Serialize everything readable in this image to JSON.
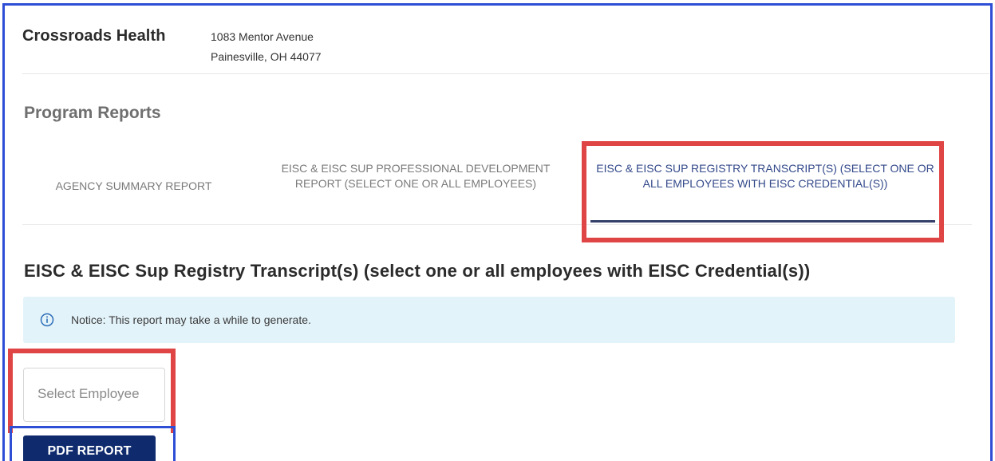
{
  "header": {
    "organization": "Crossroads Health",
    "address_line1": "1083 Mentor Avenue",
    "address_line2": "Painesville, OH 44077"
  },
  "section_title": "Program Reports",
  "tabs": [
    {
      "label": "AGENCY SUMMARY REPORT",
      "active": false
    },
    {
      "label": "EISC & EISC SUP PROFESSIONAL DEVELOPMENT REPORT (SELECT ONE OR ALL EMPLOYEES)",
      "active": false
    },
    {
      "label": "EISC & EISC SUP REGISTRY TRANSCRIPT(S) (SELECT ONE OR ALL EMPLOYEES WITH EISC CREDENTIAL(S))",
      "active": true
    }
  ],
  "report": {
    "heading": "EISC & EISC Sup Registry Transcript(s) (select one or all employees with EISC Credential(s))",
    "notice": "Notice: This report may take a while to generate.",
    "select_placeholder": "Select Employee",
    "pdf_button": "PDF REPORT"
  },
  "colors": {
    "frame_border": "#2f4ed6",
    "highlight_red": "#e04545",
    "active_tab_text": "#33498a",
    "notice_bg": "#e3f3fa",
    "button_bg": "#0f2b6e"
  },
  "icons": {
    "notice": "info-icon"
  }
}
